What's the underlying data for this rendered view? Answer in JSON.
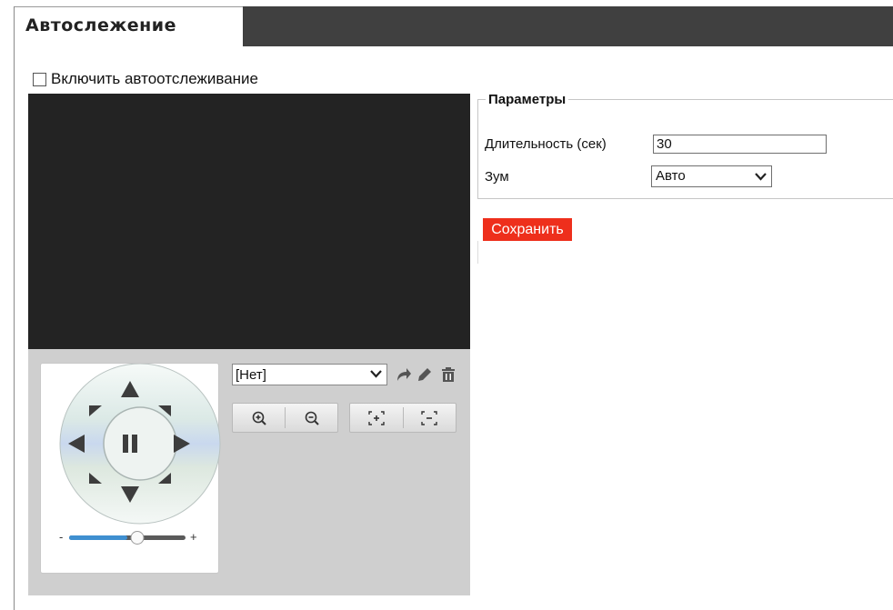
{
  "header": {
    "tab_label": "Автослежение"
  },
  "enable": {
    "label": "Включить автоотслеживание",
    "checked": false
  },
  "ptz": {
    "preset_selected": "[Нет]",
    "zoom_speed_level": 0.5
  },
  "params": {
    "legend": "Параметры",
    "duration_label": "Длительность (сек)",
    "duration_value": "30",
    "zoom_label": "Зум",
    "zoom_value": "Авто"
  },
  "actions": {
    "save_label": "Сохранить"
  },
  "colors": {
    "accent": "#ee2f1c",
    "topbar": "#404040",
    "video_bg": "#232323",
    "ptz_bg": "#cfcfcf",
    "slider": "#3f8fd0"
  },
  "icons": [
    "checkbox-icon",
    "arrow-up-icon",
    "arrow-down-icon",
    "arrow-left-icon",
    "arrow-right-icon",
    "arrow-upleft-icon",
    "arrow-upright-icon",
    "arrow-downleft-icon",
    "arrow-downright-icon",
    "pause-icon",
    "call-preset-icon",
    "edit-preset-icon",
    "delete-preset-icon",
    "zoom-in-icon",
    "zoom-out-icon",
    "focus-near-icon",
    "focus-far-icon",
    "chevron-down-icon"
  ]
}
